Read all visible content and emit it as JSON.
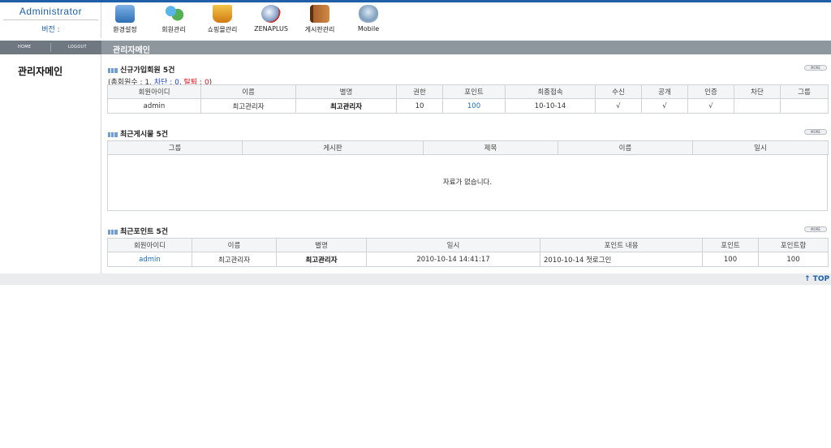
{
  "brand": {
    "title": "Administrator",
    "version_label": "버전 :"
  },
  "top_menu": [
    {
      "label": "환경설정",
      "icon": "settings-monitor-icon",
      "color": "#3b7fc4"
    },
    {
      "label": "회원관리",
      "icon": "members-icon",
      "color": "#3a9a3a"
    },
    {
      "label": "쇼핑몰관리",
      "icon": "shopping-cart-icon",
      "color": "#e2a315"
    },
    {
      "label": "ZENAPLUS",
      "icon": "globe-icon",
      "color": "#c8322a"
    },
    {
      "label": "게시판관리",
      "icon": "notebook-icon",
      "color": "#8a4d1e"
    },
    {
      "label": "Mobile",
      "icon": "mobile-icon",
      "color": "#6a8eb0"
    }
  ],
  "nav": {
    "home": "HOME",
    "logout": "LOGOUT",
    "page_title": "관리자메인"
  },
  "left": {
    "title": "관리자메인"
  },
  "sections": {
    "new_members": {
      "title": "신규가입회원 5건",
      "more": "MORE",
      "count": {
        "prefix": "(총회원수 : 1, ",
        "blocked": "차단 : 0",
        "sep": ", ",
        "left": "탈퇴 : 0",
        "suffix": ")"
      },
      "headers": [
        "회원아이디",
        "이름",
        "별명",
        "권한",
        "포인트",
        "최종접속",
        "수신",
        "공개",
        "인증",
        "차단",
        "그룹"
      ],
      "rows": [
        [
          "admin",
          "최고관리자",
          "최고관리자",
          "10",
          "100",
          "10-10-14",
          "√",
          "√",
          "√",
          "",
          ""
        ]
      ]
    },
    "recent_posts": {
      "title": "최근게시물 5건",
      "more": "MORE",
      "headers": [
        "그룹",
        "게시판",
        "제목",
        "이름",
        "일시"
      ],
      "empty": "자료가 없습니다."
    },
    "recent_points": {
      "title": "최근포인트 5건",
      "more": "MORE",
      "headers": [
        "회원아이디",
        "이름",
        "별명",
        "일시",
        "포인트 내용",
        "포인트",
        "포인트합"
      ],
      "rows": [
        [
          "admin",
          "최고관리자",
          "최고관리자",
          "2010-10-14 14:41:17",
          "2010-10-14 첫로그인",
          "100",
          "100"
        ]
      ]
    }
  },
  "footer": {
    "top": "↑ TOP"
  },
  "colors": {
    "accent": "#1f5ea8",
    "navbar": "#8e969e",
    "link": "#1a6cb5",
    "red": "#e0101a"
  }
}
